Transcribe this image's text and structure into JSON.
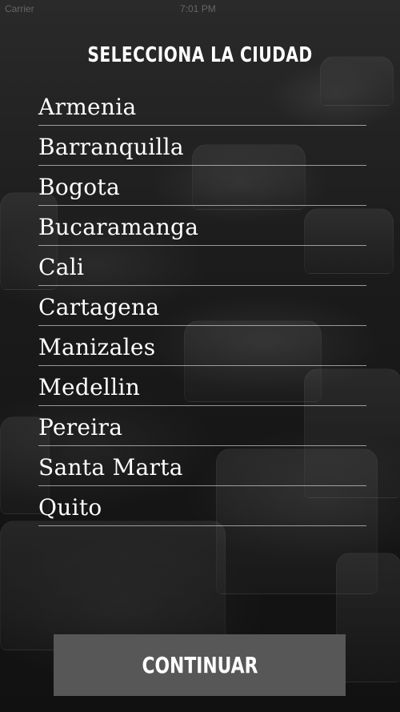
{
  "status_bar": {
    "carrier": "Carrier",
    "time": "7:01 PM"
  },
  "title": "SELECCIONA LA CIUDAD",
  "cities": [
    "Armenia",
    "Barranquilla",
    "Bogota",
    "Bucaramanga",
    "Cali",
    "Cartagena",
    "Manizales",
    "Medellin",
    "Pereira",
    "Santa Marta",
    "Quito"
  ],
  "continue_label": "CONTINUAR",
  "colors": {
    "button_bg": "#575757",
    "text": "#ffffff",
    "divider": "#ffffff"
  }
}
